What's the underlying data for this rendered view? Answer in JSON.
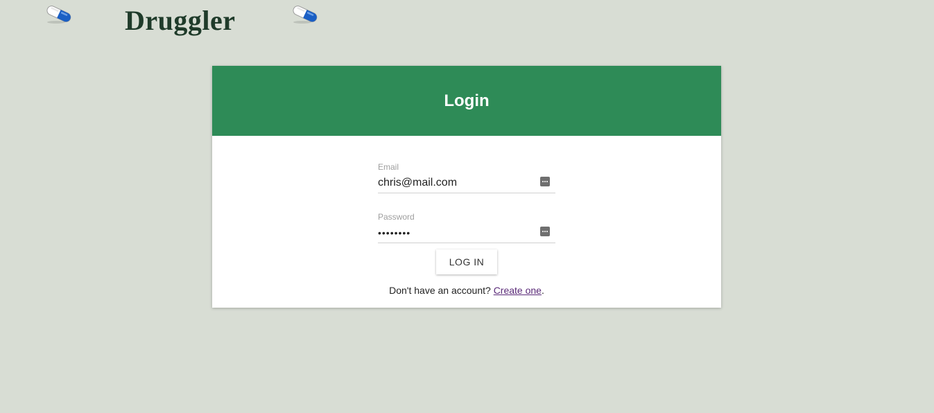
{
  "header": {
    "brand": "Druggler",
    "left_icon": "pill-capsule-icon",
    "right_icon": "pill-capsule-icon"
  },
  "login": {
    "title": "Login",
    "email_label": "Email",
    "email_value": "chris@mail.com",
    "password_label": "Password",
    "password_value": "password",
    "button_label": "LOG IN",
    "signup_prompt": "Don't have an account?",
    "signup_link": "Create one",
    "signup_suffix": "."
  },
  "colors": {
    "background": "#d8ddd4",
    "header_green": "#2e8b57",
    "brand_text": "#1f3b2a",
    "link": "#5a2a78"
  }
}
